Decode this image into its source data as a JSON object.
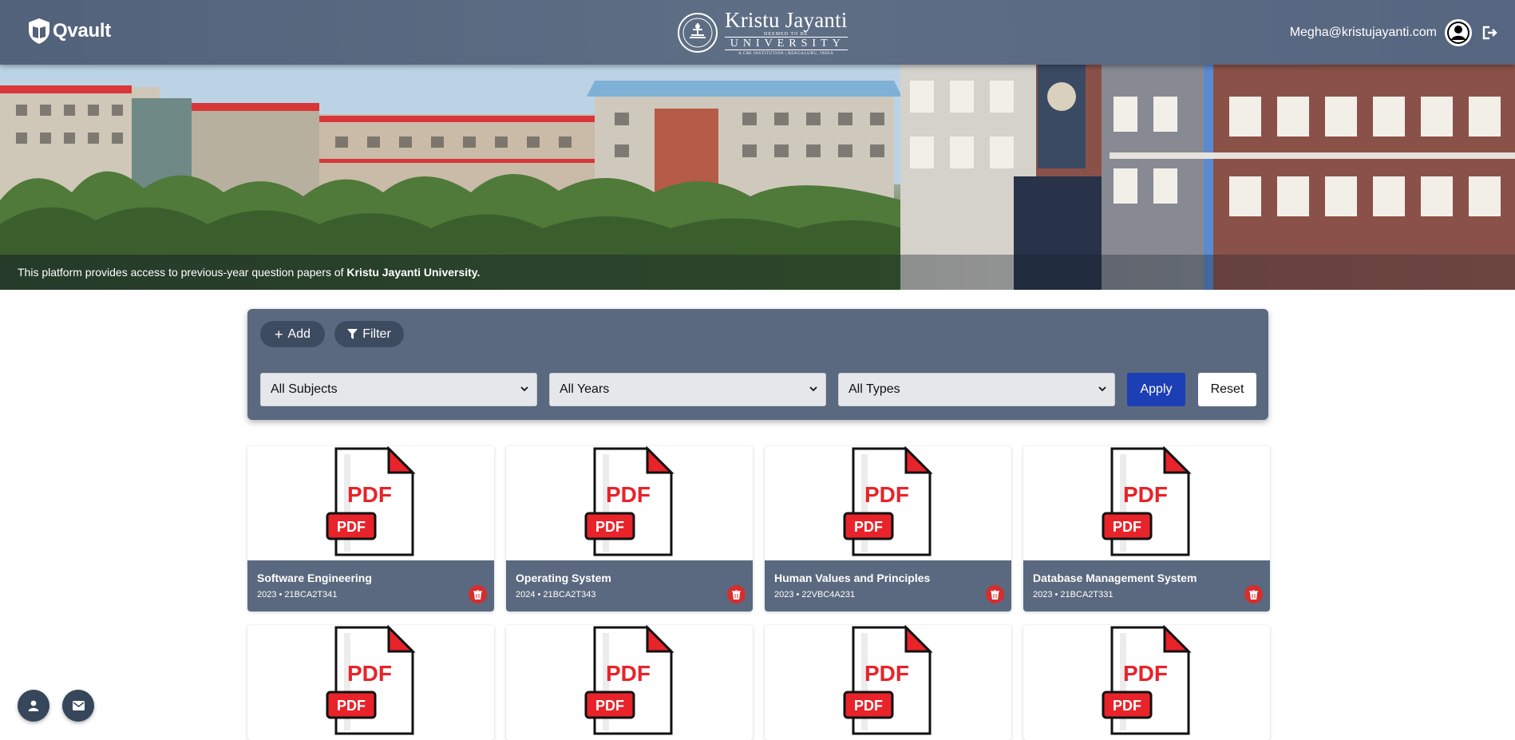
{
  "header": {
    "brand": "Qvault",
    "university": {
      "name": "Kristu Jayanti",
      "deemed": "DEEMED TO BE",
      "sub": "UNIVERSITY",
      "tagline": "A CMI INSTITUTION | BENGALURU, INDIA"
    },
    "user_email": "Megha@kristujayanti.com",
    "icons": [
      "shield-book-icon",
      "university-seal-icon",
      "user-circle-icon",
      "logout-icon"
    ]
  },
  "hero": {
    "caption_prefix": "This platform provides access to previous-year question papers of ",
    "caption_emphasis": "Kristu Jayanti University."
  },
  "toolbar": {
    "add_label": "Add",
    "filter_label": "Filter",
    "subject_selected": "All Subjects",
    "year_selected": "All Years",
    "type_selected": "All Types",
    "apply_label": "Apply",
    "reset_label": "Reset"
  },
  "thumbnail_text": {
    "main": "PDF",
    "badge": "PDF"
  },
  "papers": [
    {
      "title": "Software Engineering",
      "meta": "2023 • 21BCA2T341"
    },
    {
      "title": "Operating System",
      "meta": "2024 • 21BCA2T343"
    },
    {
      "title": "Human Values and Principles",
      "meta": "2023 • 22VBC4A231"
    },
    {
      "title": "Database Management System",
      "meta": "2023 • 21BCA2T331"
    }
  ],
  "colors": {
    "header": "#5a697f",
    "panel": "#5a697f",
    "apply": "#1c3fb5",
    "delete": "#d62d2d",
    "pdf_red": "#e8232a"
  }
}
